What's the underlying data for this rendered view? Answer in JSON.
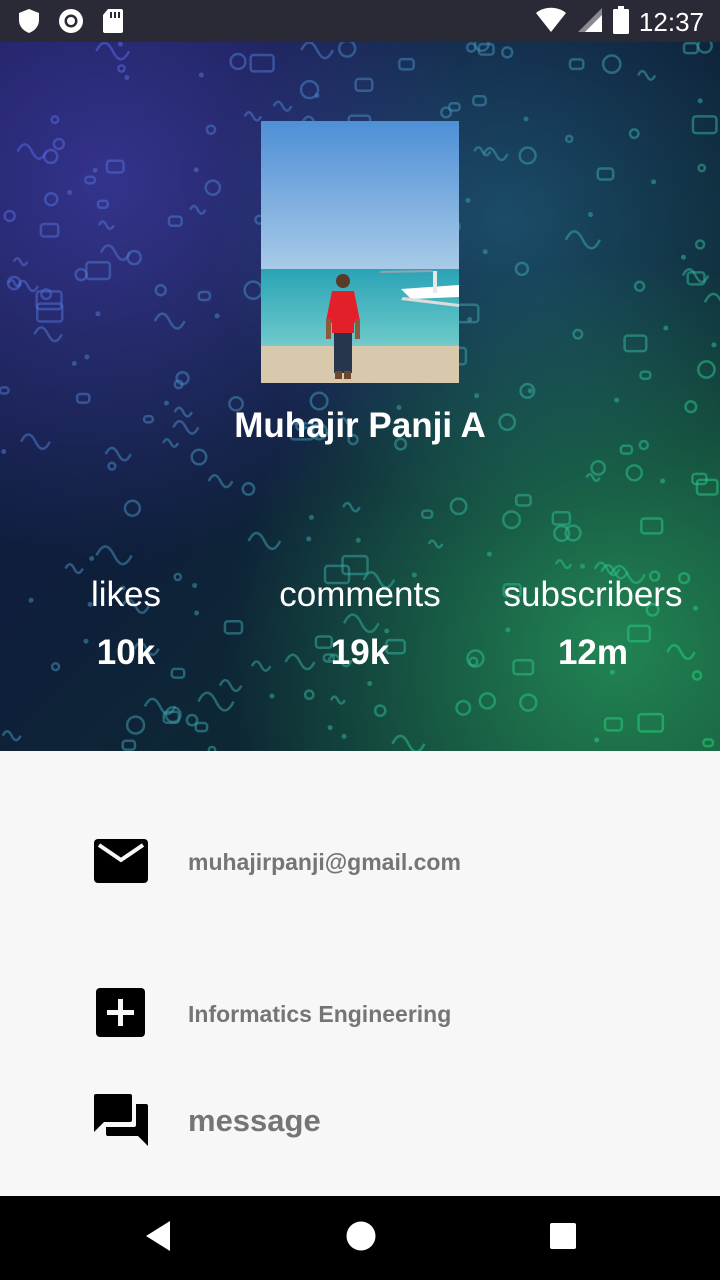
{
  "status_bar": {
    "time": "12:37",
    "icons": [
      "shield-icon",
      "circle-record-icon",
      "sd-card-icon",
      "wifi-icon",
      "signal-icon",
      "battery-icon"
    ]
  },
  "profile": {
    "name": "Muhajir Panji A",
    "stats": [
      {
        "label": "likes",
        "value": "10k"
      },
      {
        "label": "comments",
        "value": "19k"
      },
      {
        "label": "subscribers",
        "value": "12m"
      }
    ]
  },
  "details": {
    "email": "muhajirpanji@gmail.com",
    "major": "Informatics Engineering",
    "message": "message"
  },
  "nav": {
    "icons": [
      "back-icon",
      "home-icon",
      "recents-icon"
    ]
  },
  "colors": {
    "status_bar_bg": "#2a2936",
    "content_bg": "#f7f7f7",
    "text_gray": "#757575"
  }
}
